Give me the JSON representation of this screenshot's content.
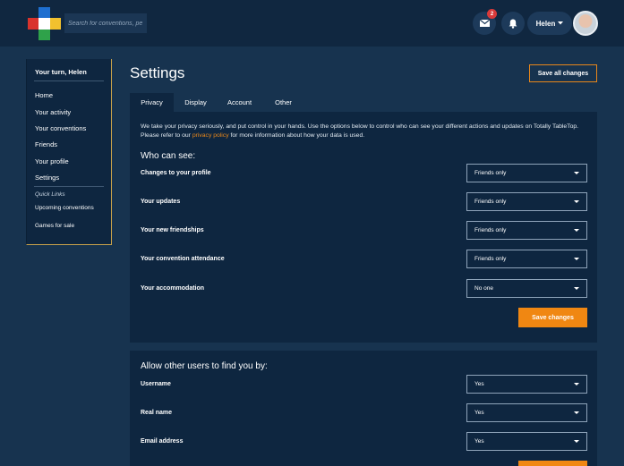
{
  "search": {
    "placeholder": "Search for conventions, pe"
  },
  "header": {
    "mail_badge": "2",
    "user_name": "Helen"
  },
  "sidebar": {
    "greeting": "Your turn, Helen",
    "items": [
      "Home",
      "Your activity",
      "Your conventions",
      "Friends",
      "Your profile",
      "Settings"
    ],
    "quick_links_label": "Quick Links",
    "quick_links": [
      "Upcoming conventions",
      "Games for sale"
    ]
  },
  "page": {
    "title": "Settings",
    "save_all_label": "Save all changes"
  },
  "tabs": [
    "Privacy",
    "Display",
    "Account",
    "Other"
  ],
  "privacy": {
    "intro_before_link": "We take your privacy seriously, and put control in your hands. Use the options below to control who can see your different actions and updates on Totally TableTop. Please refer to our ",
    "intro_link": "privacy policy",
    "intro_after_link": " for more information about how your data is used.",
    "who_can_see_title": "Who can see:",
    "rows": [
      {
        "label": "Changes to your profile",
        "value": "Friends only"
      },
      {
        "label": "Your updates",
        "value": "Friends only"
      },
      {
        "label": "Your new friendships",
        "value": "Friends only"
      },
      {
        "label": "Your convention attendance",
        "value": "Friends only"
      },
      {
        "label": "Your accommodation",
        "value": "No one"
      }
    ],
    "save_label": "Save changes"
  },
  "find": {
    "title": "Allow other users to find you by:",
    "rows": [
      {
        "label": "Username",
        "value": "Yes"
      },
      {
        "label": "Real name",
        "value": "Yes"
      },
      {
        "label": "Email address",
        "value": "Yes"
      }
    ]
  },
  "colors": {
    "background": "#17334f",
    "topbar": "#102740",
    "panel": "#0e2640",
    "accent": "#f08712",
    "link": "#e8871a"
  }
}
